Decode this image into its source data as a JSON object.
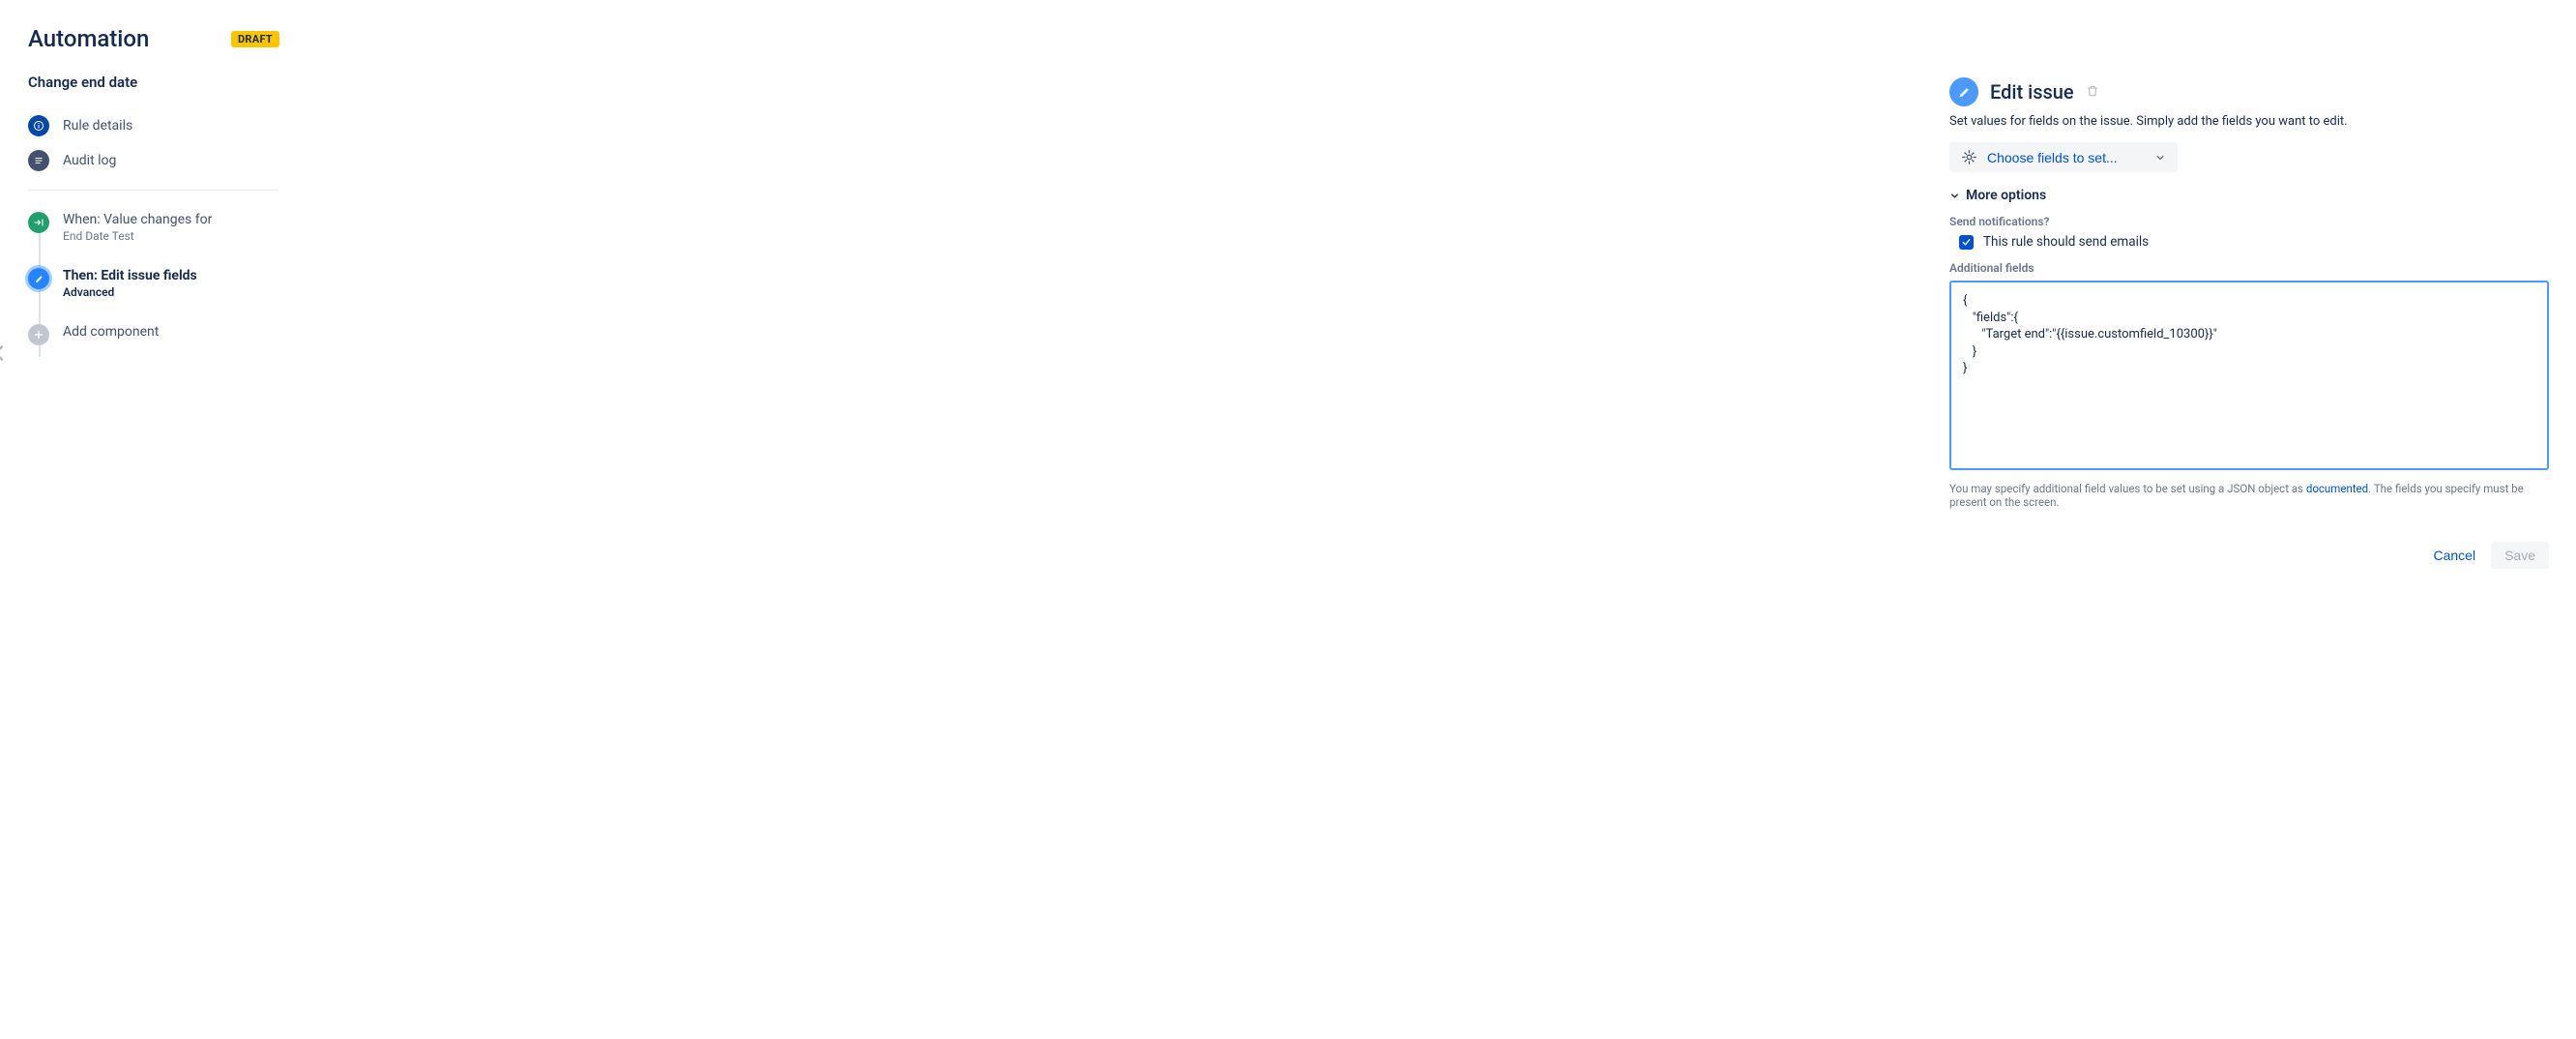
{
  "sidebar": {
    "page_title": "Automation",
    "status_badge": "DRAFT",
    "rule_name": "Change end date",
    "nav": {
      "rule_details": "Rule details",
      "audit_log": "Audit log"
    },
    "steps": {
      "trigger": {
        "title": "When: Value changes for",
        "sub": "End Date Test"
      },
      "action": {
        "title": "Then: Edit issue fields",
        "sub": "Advanced"
      },
      "add": {
        "title": "Add component"
      }
    }
  },
  "panel": {
    "title": "Edit issue",
    "description": "Set values for fields on the issue. Simply add the fields you want to edit.",
    "choose_fields_label": "Choose fields to set...",
    "more_options_label": "More options",
    "notifications_label": "Send notifications?",
    "notifications_checkbox_label": "This rule should send emails",
    "notifications_checked": true,
    "additional_fields_label": "Additional fields",
    "additional_fields_value": "{\n   \"fields\":{\n      \"Target end\":\"{{issue.customfield_10300}}\"\n   }\n}",
    "help_text_before": "You may specify additional field values to be set using a JSON object as ",
    "help_link_text": "documented",
    "help_text_after": ". The fields you specify must be present on the screen.",
    "cancel_label": "Cancel",
    "save_label": "Save"
  }
}
